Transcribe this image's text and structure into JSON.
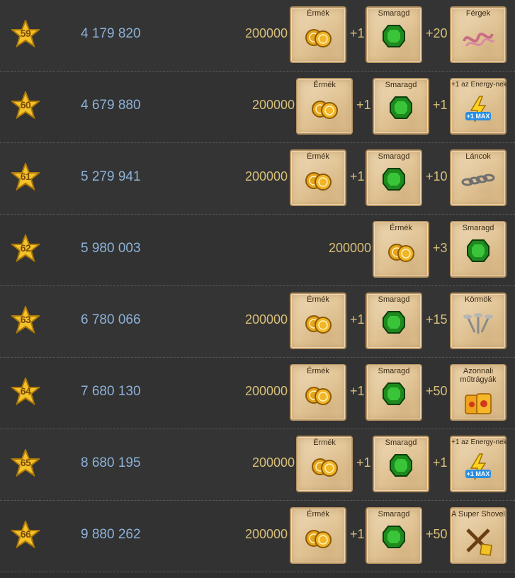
{
  "rows": [
    {
      "level": "59",
      "xp": "4 179 820",
      "coins": "200000",
      "r1_label": "Érmék",
      "r2_qty": "+1",
      "r2_label": "Smaragd",
      "r3_qty": "+20",
      "r3_label": "Férgek",
      "r3_icon": "worms-icon"
    },
    {
      "level": "60",
      "xp": "4 679 880",
      "coins": "200000",
      "r1_label": "Érmék",
      "r2_qty": "+1",
      "r2_label": "Smaragd",
      "r3_qty": "+1",
      "r3_label": "+1 az Energy-nek",
      "r3_icon": "energy-max-icon",
      "r3_badge": "+1 MAX"
    },
    {
      "level": "61",
      "xp": "5 279 941",
      "coins": "200000",
      "r1_label": "Érmék",
      "r2_qty": "+1",
      "r2_label": "Smaragd",
      "r3_qty": "+10",
      "r3_label": "Láncok",
      "r3_icon": "chains-icon"
    },
    {
      "level": "62",
      "xp": "5 980 003",
      "coins": "200000",
      "r1_label": "Érmék",
      "r2_qty": "+3",
      "r2_label": "Smaragd"
    },
    {
      "level": "63",
      "xp": "6 780 066",
      "coins": "200000",
      "r1_label": "Érmék",
      "r2_qty": "+1",
      "r2_label": "Smaragd",
      "r3_qty": "+15",
      "r3_label": "Körmök",
      "r3_icon": "nails-icon"
    },
    {
      "level": "64",
      "xp": "7 680 130",
      "coins": "200000",
      "r1_label": "Érmék",
      "r2_qty": "+1",
      "r2_label": "Smaragd",
      "r3_qty": "+50",
      "r3_label": "Azonnali műtrágyák",
      "r3_icon": "fertilizer-icon"
    },
    {
      "level": "65",
      "xp": "8 680 195",
      "coins": "200000",
      "r1_label": "Érmék",
      "r2_qty": "+1",
      "r2_label": "Smaragd",
      "r3_qty": "+1",
      "r3_label": "+1 az Energy-nek",
      "r3_icon": "energy-max-icon",
      "r3_badge": "+1 MAX"
    },
    {
      "level": "66",
      "xp": "9 880 262",
      "coins": "200000",
      "r1_label": "Érmék",
      "r2_qty": "+1",
      "r2_label": "Smaragd",
      "r3_qty": "+50",
      "r3_label": "A Super Shovel",
      "r3_icon": "super-shovel-icon"
    }
  ],
  "colors": {
    "xp": "#8db2d9",
    "amount": "#d8bf79",
    "card": "#e3c697"
  }
}
